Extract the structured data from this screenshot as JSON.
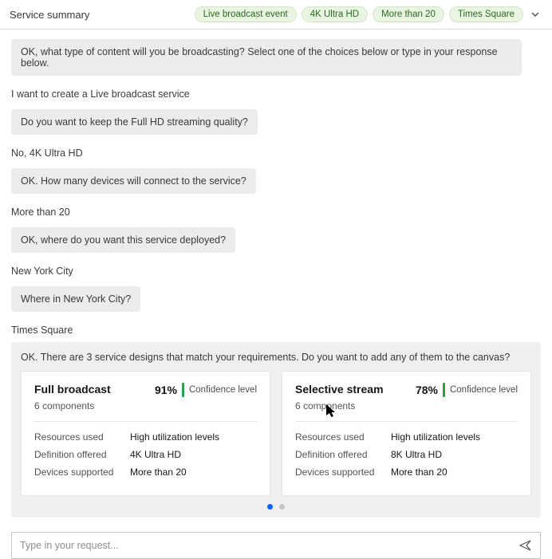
{
  "header": {
    "title": "Service summary",
    "tags": [
      "Live broadcast event",
      "4K Ultra HD",
      "More than 20",
      "Times Square"
    ]
  },
  "conversation": [
    {
      "role": "bot",
      "text": "OK, what type of content will you be broadcasting? Select one of the choices below or type in your response below."
    },
    {
      "role": "user",
      "text": "I want to create a Live broadcast service"
    },
    {
      "role": "bot",
      "text": "Do you want to keep the Full HD streaming quality?"
    },
    {
      "role": "user",
      "text": "No, 4K Ultra HD"
    },
    {
      "role": "bot",
      "text": "OK. How many devices will connect to the service?"
    },
    {
      "role": "user",
      "text": "More than 20"
    },
    {
      "role": "bot",
      "text": "OK, where do you want this service deployed?"
    },
    {
      "role": "user",
      "text": "New York City"
    },
    {
      "role": "bot",
      "text": "Where in New York City?"
    },
    {
      "role": "user",
      "text": "Times Square"
    }
  ],
  "results": {
    "heading": "OK. There are 3 service designs that match your requirements. Do you want to add any of them to the canvas?",
    "cards": [
      {
        "title": "Full broadcast",
        "confidence_pct": "91%",
        "confidence_label": "Confidence level",
        "components": "6 components",
        "rows": [
          {
            "label": "Resources used",
            "value": "High utilization levels"
          },
          {
            "label": "Definition offered",
            "value": "4K Ultra HD"
          },
          {
            "label": "Devices supported",
            "value": "More than 20"
          }
        ]
      },
      {
        "title": "Selective stream",
        "confidence_pct": "78%",
        "confidence_label": "Confidence level",
        "components": "6 components",
        "rows": [
          {
            "label": "Resources used",
            "value": "High utilization levels"
          },
          {
            "label": "Definition offered",
            "value": "8K Ultra HD"
          },
          {
            "label": "Devices supported",
            "value": "More than 20"
          }
        ]
      }
    ],
    "page_dots": {
      "count": 2,
      "active": 0
    }
  },
  "input": {
    "placeholder": "Type in your request..."
  }
}
